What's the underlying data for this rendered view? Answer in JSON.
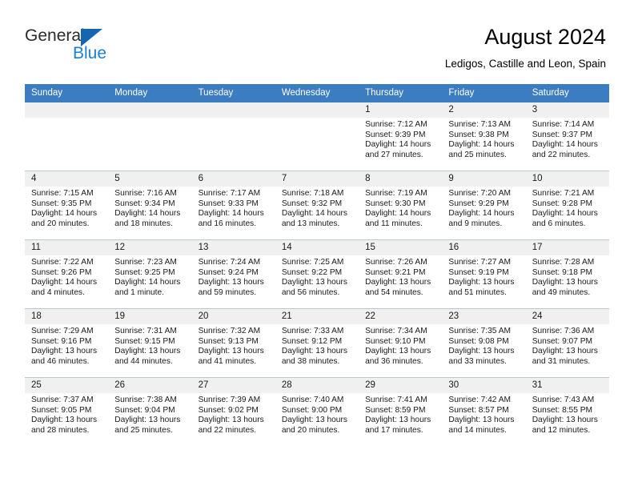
{
  "brand": {
    "name_top": "General",
    "name_bottom": "Blue",
    "triangle_color": "#1565b0",
    "blue_text_color": "#1b7fd4"
  },
  "header": {
    "title": "August 2024",
    "subtitle": "Ledigos, Castille and Leon, Spain"
  },
  "theme": {
    "header_row_bg": "#3b7dc0",
    "header_row_text": "#ffffff",
    "daynum_bg": "#f0f0f0",
    "grid_line": "#bfc7ce"
  },
  "weekdays": [
    "Sunday",
    "Monday",
    "Tuesday",
    "Wednesday",
    "Thursday",
    "Friday",
    "Saturday"
  ],
  "weeks": [
    [
      {
        "day": "",
        "empty": true,
        "sunrise": "",
        "sunset": "",
        "daylight_line1": "",
        "daylight_line2": ""
      },
      {
        "day": "",
        "empty": true,
        "sunrise": "",
        "sunset": "",
        "daylight_line1": "",
        "daylight_line2": ""
      },
      {
        "day": "",
        "empty": true,
        "sunrise": "",
        "sunset": "",
        "daylight_line1": "",
        "daylight_line2": ""
      },
      {
        "day": "",
        "empty": true,
        "sunrise": "",
        "sunset": "",
        "daylight_line1": "",
        "daylight_line2": ""
      },
      {
        "day": "1",
        "sunrise": "Sunrise: 7:12 AM",
        "sunset": "Sunset: 9:39 PM",
        "daylight_line1": "Daylight: 14 hours",
        "daylight_line2": "and 27 minutes."
      },
      {
        "day": "2",
        "sunrise": "Sunrise: 7:13 AM",
        "sunset": "Sunset: 9:38 PM",
        "daylight_line1": "Daylight: 14 hours",
        "daylight_line2": "and 25 minutes."
      },
      {
        "day": "3",
        "sunrise": "Sunrise: 7:14 AM",
        "sunset": "Sunset: 9:37 PM",
        "daylight_line1": "Daylight: 14 hours",
        "daylight_line2": "and 22 minutes."
      }
    ],
    [
      {
        "day": "4",
        "sunrise": "Sunrise: 7:15 AM",
        "sunset": "Sunset: 9:35 PM",
        "daylight_line1": "Daylight: 14 hours",
        "daylight_line2": "and 20 minutes."
      },
      {
        "day": "5",
        "sunrise": "Sunrise: 7:16 AM",
        "sunset": "Sunset: 9:34 PM",
        "daylight_line1": "Daylight: 14 hours",
        "daylight_line2": "and 18 minutes."
      },
      {
        "day": "6",
        "sunrise": "Sunrise: 7:17 AM",
        "sunset": "Sunset: 9:33 PM",
        "daylight_line1": "Daylight: 14 hours",
        "daylight_line2": "and 16 minutes."
      },
      {
        "day": "7",
        "sunrise": "Sunrise: 7:18 AM",
        "sunset": "Sunset: 9:32 PM",
        "daylight_line1": "Daylight: 14 hours",
        "daylight_line2": "and 13 minutes."
      },
      {
        "day": "8",
        "sunrise": "Sunrise: 7:19 AM",
        "sunset": "Sunset: 9:30 PM",
        "daylight_line1": "Daylight: 14 hours",
        "daylight_line2": "and 11 minutes."
      },
      {
        "day": "9",
        "sunrise": "Sunrise: 7:20 AM",
        "sunset": "Sunset: 9:29 PM",
        "daylight_line1": "Daylight: 14 hours",
        "daylight_line2": "and 9 minutes."
      },
      {
        "day": "10",
        "sunrise": "Sunrise: 7:21 AM",
        "sunset": "Sunset: 9:28 PM",
        "daylight_line1": "Daylight: 14 hours",
        "daylight_line2": "and 6 minutes."
      }
    ],
    [
      {
        "day": "11",
        "sunrise": "Sunrise: 7:22 AM",
        "sunset": "Sunset: 9:26 PM",
        "daylight_line1": "Daylight: 14 hours",
        "daylight_line2": "and 4 minutes."
      },
      {
        "day": "12",
        "sunrise": "Sunrise: 7:23 AM",
        "sunset": "Sunset: 9:25 PM",
        "daylight_line1": "Daylight: 14 hours",
        "daylight_line2": "and 1 minute."
      },
      {
        "day": "13",
        "sunrise": "Sunrise: 7:24 AM",
        "sunset": "Sunset: 9:24 PM",
        "daylight_line1": "Daylight: 13 hours",
        "daylight_line2": "and 59 minutes."
      },
      {
        "day": "14",
        "sunrise": "Sunrise: 7:25 AM",
        "sunset": "Sunset: 9:22 PM",
        "daylight_line1": "Daylight: 13 hours",
        "daylight_line2": "and 56 minutes."
      },
      {
        "day": "15",
        "sunrise": "Sunrise: 7:26 AM",
        "sunset": "Sunset: 9:21 PM",
        "daylight_line1": "Daylight: 13 hours",
        "daylight_line2": "and 54 minutes."
      },
      {
        "day": "16",
        "sunrise": "Sunrise: 7:27 AM",
        "sunset": "Sunset: 9:19 PM",
        "daylight_line1": "Daylight: 13 hours",
        "daylight_line2": "and 51 minutes."
      },
      {
        "day": "17",
        "sunrise": "Sunrise: 7:28 AM",
        "sunset": "Sunset: 9:18 PM",
        "daylight_line1": "Daylight: 13 hours",
        "daylight_line2": "and 49 minutes."
      }
    ],
    [
      {
        "day": "18",
        "sunrise": "Sunrise: 7:29 AM",
        "sunset": "Sunset: 9:16 PM",
        "daylight_line1": "Daylight: 13 hours",
        "daylight_line2": "and 46 minutes."
      },
      {
        "day": "19",
        "sunrise": "Sunrise: 7:31 AM",
        "sunset": "Sunset: 9:15 PM",
        "daylight_line1": "Daylight: 13 hours",
        "daylight_line2": "and 44 minutes."
      },
      {
        "day": "20",
        "sunrise": "Sunrise: 7:32 AM",
        "sunset": "Sunset: 9:13 PM",
        "daylight_line1": "Daylight: 13 hours",
        "daylight_line2": "and 41 minutes."
      },
      {
        "day": "21",
        "sunrise": "Sunrise: 7:33 AM",
        "sunset": "Sunset: 9:12 PM",
        "daylight_line1": "Daylight: 13 hours",
        "daylight_line2": "and 38 minutes."
      },
      {
        "day": "22",
        "sunrise": "Sunrise: 7:34 AM",
        "sunset": "Sunset: 9:10 PM",
        "daylight_line1": "Daylight: 13 hours",
        "daylight_line2": "and 36 minutes."
      },
      {
        "day": "23",
        "sunrise": "Sunrise: 7:35 AM",
        "sunset": "Sunset: 9:08 PM",
        "daylight_line1": "Daylight: 13 hours",
        "daylight_line2": "and 33 minutes."
      },
      {
        "day": "24",
        "sunrise": "Sunrise: 7:36 AM",
        "sunset": "Sunset: 9:07 PM",
        "daylight_line1": "Daylight: 13 hours",
        "daylight_line2": "and 31 minutes."
      }
    ],
    [
      {
        "day": "25",
        "sunrise": "Sunrise: 7:37 AM",
        "sunset": "Sunset: 9:05 PM",
        "daylight_line1": "Daylight: 13 hours",
        "daylight_line2": "and 28 minutes."
      },
      {
        "day": "26",
        "sunrise": "Sunrise: 7:38 AM",
        "sunset": "Sunset: 9:04 PM",
        "daylight_line1": "Daylight: 13 hours",
        "daylight_line2": "and 25 minutes."
      },
      {
        "day": "27",
        "sunrise": "Sunrise: 7:39 AM",
        "sunset": "Sunset: 9:02 PM",
        "daylight_line1": "Daylight: 13 hours",
        "daylight_line2": "and 22 minutes."
      },
      {
        "day": "28",
        "sunrise": "Sunrise: 7:40 AM",
        "sunset": "Sunset: 9:00 PM",
        "daylight_line1": "Daylight: 13 hours",
        "daylight_line2": "and 20 minutes."
      },
      {
        "day": "29",
        "sunrise": "Sunrise: 7:41 AM",
        "sunset": "Sunset: 8:59 PM",
        "daylight_line1": "Daylight: 13 hours",
        "daylight_line2": "and 17 minutes."
      },
      {
        "day": "30",
        "sunrise": "Sunrise: 7:42 AM",
        "sunset": "Sunset: 8:57 PM",
        "daylight_line1": "Daylight: 13 hours",
        "daylight_line2": "and 14 minutes."
      },
      {
        "day": "31",
        "sunrise": "Sunrise: 7:43 AM",
        "sunset": "Sunset: 8:55 PM",
        "daylight_line1": "Daylight: 13 hours",
        "daylight_line2": "and 12 minutes."
      }
    ]
  ]
}
